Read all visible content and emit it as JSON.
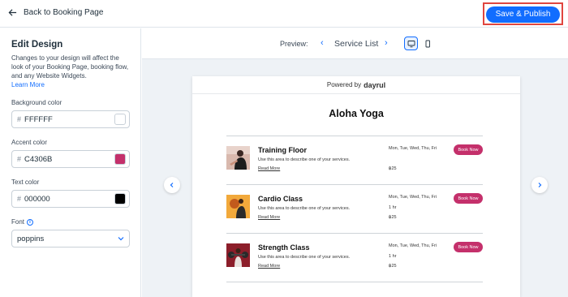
{
  "topbar": {
    "back_label": "Back to Booking Page",
    "publish_label": "Save & Publish",
    "publish_color": "#116dff"
  },
  "sidebar": {
    "title": "Edit Design",
    "description": "Changes to your design will affect the look of your Booking Page, booking flow, and any Website Widgets.",
    "learn_more": "Learn More",
    "background_label": "Background color",
    "background_hex": "FFFFFF",
    "background_color": "#FFFFFF",
    "accent_label": "Accent color",
    "accent_hex": "C4306B",
    "accent_color": "#C4306B",
    "text_label": "Text color",
    "text_hex": "000000",
    "text_color": "#000000",
    "font_label": "Font",
    "font_value": "poppins",
    "hash": "#"
  },
  "preview": {
    "label": "Preview:",
    "page": "Service List",
    "device_selected": "desktop"
  },
  "booking_page": {
    "powered_by": "Powered by",
    "brand": "dayrul",
    "title": "Aloha Yoga",
    "services": [
      {
        "name": "Training Floor",
        "description": "Use this area to describe one of your services.",
        "read_more": "Read More",
        "days": "Mon, Tue, Wed, Thu, Fri",
        "duration": "",
        "price": "฿25",
        "button": "Book Now"
      },
      {
        "name": "Cardio Class",
        "description": "Use this area to describe one of your services.",
        "read_more": "Read More",
        "days": "Mon, Tue, Wed, Thu, Fri",
        "duration": "1 hr",
        "price": "฿25",
        "button": "Book Now"
      },
      {
        "name": "Strength Class",
        "description": "Use this area to describe one of your services.",
        "read_more": "Read More",
        "days": "Mon, Tue, Wed, Thu, Fri",
        "duration": "1 hr",
        "price": "฿25",
        "button": "Book Now"
      }
    ]
  }
}
